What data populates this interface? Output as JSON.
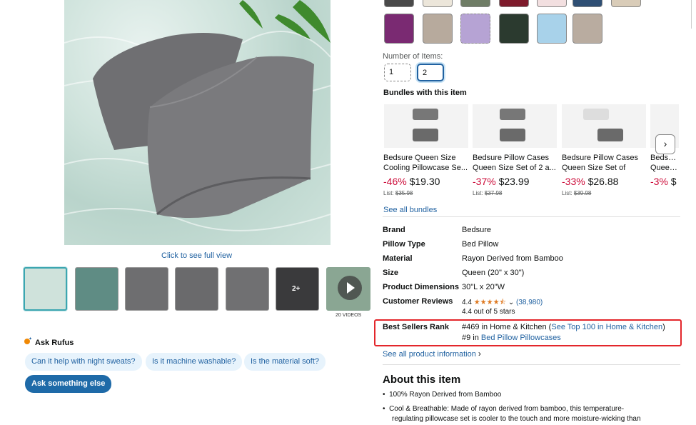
{
  "swatch_rows": {
    "top": [
      "#4a4a4a",
      "#ece6da",
      "#6f7d66",
      "#7e1a2b",
      "#f2dfe0",
      "#2f4f74",
      "#d9ccb8"
    ],
    "bottom": [
      "#7a2a72",
      "#b7aa9d",
      "#b6a3d4",
      "#2b3a2f",
      "#a8d2ea",
      "#b9aca0"
    ]
  },
  "number_of_items": {
    "label": "Number of Items:",
    "options": [
      "1",
      "2"
    ],
    "selected": "2"
  },
  "gallery": {
    "click_full_view": "Click to see full view",
    "video_count": "20 VIDEOS",
    "thumb_badge": "2+"
  },
  "rufus": {
    "title": "Ask Rufus",
    "questions": [
      "Can it help with night sweats?",
      "Is it machine washable?",
      "Is the material soft?"
    ],
    "ask_button": "Ask something else"
  },
  "bundles": {
    "title": "Bundles with this item",
    "items": [
      {
        "title1": "Bedsure Queen Size",
        "title2": "Cooling Pillowcase Se...",
        "discount": "-46%",
        "price": "$19.30",
        "list_label": "List:",
        "list_price": "$35.98"
      },
      {
        "title1": "Bedsure Pillow Cases",
        "title2": "Queen Size Set of 2 a...",
        "discount": "-37%",
        "price": "$23.99",
        "list_label": "List:",
        "list_price": "$37.98"
      },
      {
        "title1": "Bedsure Pillow Cases",
        "title2": "Queen Size Set of",
        "discount": "-33%",
        "price": "$26.88",
        "list_label": "List:",
        "list_price": "$39.98"
      },
      {
        "title1": "Bedsure",
        "title2": "Queen S",
        "discount": "-3%",
        "price": "$",
        "list_label": "",
        "list_price": ""
      }
    ],
    "see_all": "See all bundles"
  },
  "details": {
    "brand": {
      "label": "Brand",
      "value": "Bedsure"
    },
    "pillow_type": {
      "label": "Pillow Type",
      "value": "Bed Pillow"
    },
    "material": {
      "label": "Material",
      "value": "Rayon Derived from Bamboo"
    },
    "size": {
      "label": "Size",
      "value": "Queen (20\" x 30\")"
    },
    "dimensions": {
      "label": "Product Dimensions",
      "value": "30\"L x 20\"W"
    },
    "reviews": {
      "label": "Customer Reviews",
      "rating": "4.4",
      "stars": 4.4,
      "count": "(38,980)",
      "out_of": "4.4 out of 5 stars"
    },
    "best_sellers": {
      "label": "Best Sellers Rank",
      "rank1": "#469 in Home & Kitchen (",
      "rank1_link": "See Top 100 in Home & Kitchen",
      "rank1_end": ")",
      "rank2": "#9 in ",
      "rank2_link": "Bed Pillow Pillowcases"
    },
    "see_all_info": "See all product information"
  },
  "about": {
    "title": "About this item",
    "bullets": [
      "100% Rayon Derived from Bamboo",
      "Cool & Breathable: Made of rayon derived from bamboo, this temperature-",
      "regulating pillowcase set is cooler to the touch and more moisture-wicking than"
    ]
  },
  "colors": {
    "link": "#2162a1",
    "discount": "#cc0c39",
    "highlight": "#e3262b",
    "star": "#de7921"
  }
}
